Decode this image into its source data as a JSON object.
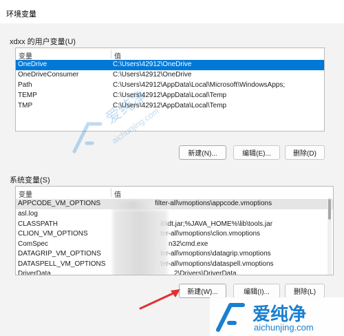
{
  "window": {
    "title": "环境变量"
  },
  "user_vars": {
    "group_label": "xdxx 的用户变量(U)",
    "col_variable": "变量",
    "col_value": "值",
    "rows": [
      {
        "name": "OneDrive",
        "value": "C:\\Users\\42912\\OneDrive",
        "selected": true
      },
      {
        "name": "OneDriveConsumer",
        "value": "C:\\Users\\42912\\OneDrive"
      },
      {
        "name": "Path",
        "value": "C:\\Users\\42912\\AppData\\Local\\Microsoft\\WindowsApps;"
      },
      {
        "name": "TEMP",
        "value": "C:\\Users\\42912\\AppData\\Local\\Temp"
      },
      {
        "name": "TMP",
        "value": "C:\\Users\\42912\\AppData\\Local\\Temp"
      }
    ],
    "buttons": {
      "new": "新建(N)...",
      "edit": "编辑(E)...",
      "delete": "删除(D)"
    }
  },
  "system_vars": {
    "group_label": "系统变量(S)",
    "col_variable": "变量",
    "col_value": "值",
    "rows": [
      {
        "name": "APPCODE_VM_OPTIONS",
        "value": "filter-all\\vmoptions\\appcode.vmoptions"
      },
      {
        "name": "asl.log",
        "value": ""
      },
      {
        "name": "CLASSPATH",
        "value": "ib\\dt.jar;%JAVA_HOME%\\lib\\tools.jar"
      },
      {
        "name": "CLION_VM_OPTIONS",
        "value": "ter-all\\vmoptions\\clion.vmoptions"
      },
      {
        "name": "ComSpec",
        "value": "n32\\cmd.exe"
      },
      {
        "name": "DATAGRIP_VM_OPTIONS",
        "value": "ter-all\\vmoptions\\datagrip.vmoptions"
      },
      {
        "name": "DATASPELL_VM_OPTIONS",
        "value": "ter-all\\vmoptions\\dataspell.vmoptions"
      },
      {
        "name": "DriverData",
        "value": "2\\Drivers\\DriverData"
      }
    ],
    "buttons": {
      "new": "新建(W)...",
      "edit": "编辑(I)...",
      "delete": "删除(L)"
    }
  },
  "watermark": {
    "brand": "爱纯净",
    "url": "aichunjing.com"
  },
  "colors": {
    "selection": "#0078d7",
    "arrow": "#e0312f",
    "watermark_blue": "#1a7fd0"
  }
}
